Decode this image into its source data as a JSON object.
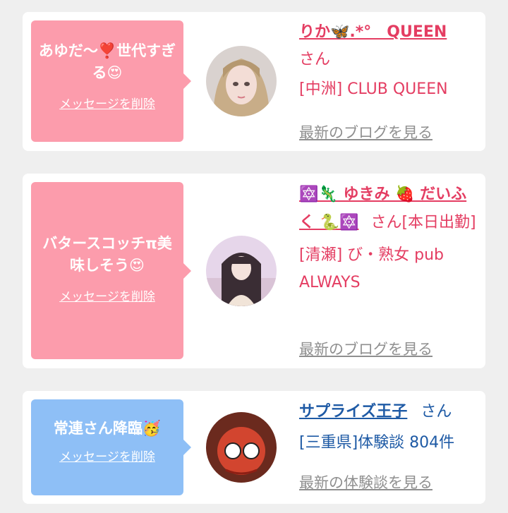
{
  "messages": [
    {
      "bubble_color": "#fc9cac",
      "bubble_text": "あゆだ〜❣️世代すぎる😍",
      "delete_label": "メッセージを削除",
      "name": "りか🦋.*°　QUEEN",
      "honorific": "さん",
      "shop": "[中洲] CLUB QUEEN",
      "link_label": "最新のブログを見る",
      "text_color": "#e43d62"
    },
    {
      "bubble_color": "#fc9cac",
      "bubble_text": "バタースコッチπ美味しそう😍",
      "delete_label": "メッセージを削除",
      "name": "🔯🦎 ゆきみ 🍓 だいふく 🐍🔯",
      "honorific": "さん[本日出勤]",
      "shop": "[清瀬] び・熟女 pub ALWAYS",
      "link_label": "最新のブログを見る",
      "text_color": "#e43d62"
    },
    {
      "bubble_color": "#8ebff6",
      "bubble_text": "常連さん降臨🥳",
      "delete_label": "メッセージを削除",
      "name": "サプライズ王子",
      "honorific": "さん",
      "shop": "[三重県]体験談 804件",
      "link_label": "最新の体験談を見る",
      "text_color": "#1e5aa5"
    }
  ]
}
